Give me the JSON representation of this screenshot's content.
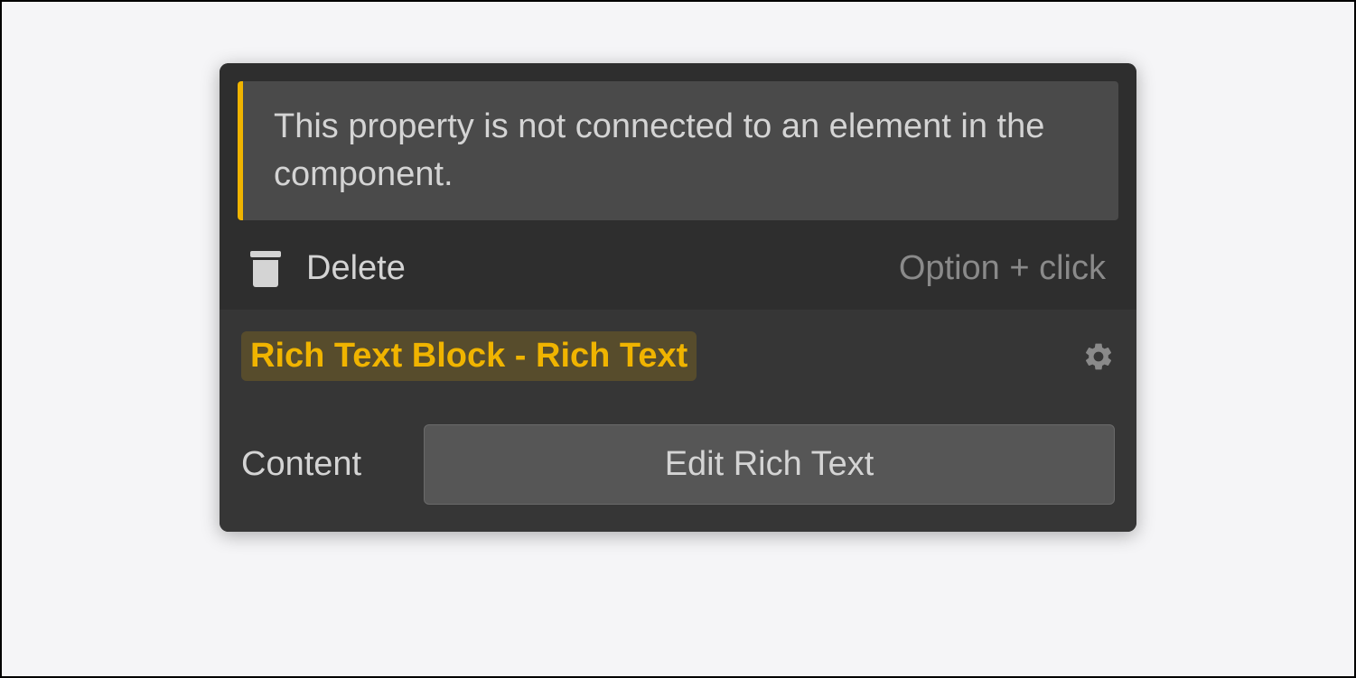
{
  "warning": {
    "message": "This property is not connected to an element in the component."
  },
  "action": {
    "label": "Delete",
    "shortcut": "Option + click"
  },
  "section": {
    "title": "Rich Text Block - Rich Text"
  },
  "content": {
    "label": "Content",
    "button_label": "Edit Rich Text"
  }
}
